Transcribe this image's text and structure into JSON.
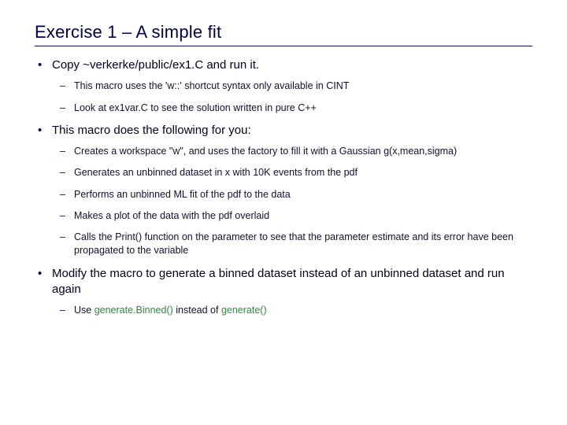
{
  "title": "Exercise 1 – A simple fit",
  "b1": {
    "text": "Copy ~verkerke/public/ex1.C and run it.",
    "sub": [
      "This macro uses the 'w::' shortcut syntax only available in CINT",
      "Look at ex1var.C to see the solution written in pure C++"
    ]
  },
  "b2": {
    "text": "This macro does the following for you:",
    "sub": [
      "Creates a workspace \"w\", and uses the factory to fill it with a Gaussian g(x,mean,sigma)",
      "Generates an unbinned dataset in x with 10K events from the pdf",
      "Performs an unbinned ML fit of the pdf to the data",
      "Makes a plot of the data with the pdf overlaid",
      "Calls the Print() function on the parameter to see that the parameter estimate and its error have been propagated to the variable"
    ]
  },
  "b3": {
    "text": "Modify the macro to generate a binned dataset instead of an unbinned dataset and run again",
    "sub_prefix": "Use ",
    "code1": "generate.Binned()",
    "mid": "  instead of ",
    "code2": "generate()"
  }
}
